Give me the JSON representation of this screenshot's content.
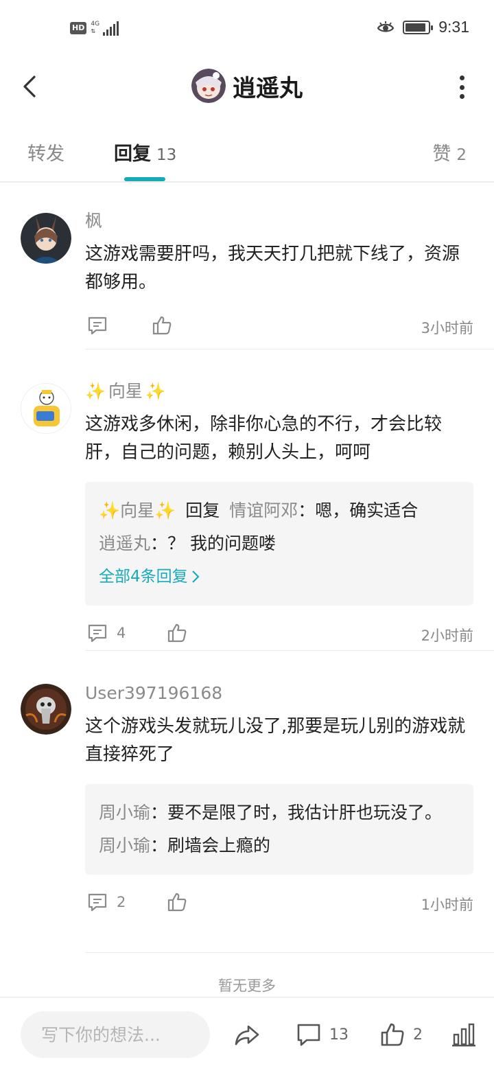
{
  "status_bar": {
    "hd": "HD",
    "network": "4G",
    "time": "9:31",
    "battery_level": 0.9
  },
  "header": {
    "title": "逍遥丸",
    "back_icon": "chevron-left-icon",
    "more_icon": "more-vertical-icon"
  },
  "tabs": {
    "forward": {
      "label": "转发"
    },
    "reply": {
      "label": "回复",
      "count": "13"
    },
    "like": {
      "label": "赞",
      "count": "2"
    }
  },
  "comments": [
    {
      "username": "枫",
      "content": "这游戏需要肝吗，我天天打几把就下线了，资源都够用。",
      "reply_count": "",
      "time": "3小时前"
    },
    {
      "username": "向星",
      "content": "这游戏多休闲，除非你心急的不行，才会比较肝，自己的问题，赖别人头上，呵呵",
      "sub_replies": [
        {
          "user": "✨向星✨",
          "reply_word": "回复",
          "target": "情谊阿邓",
          "text": "：嗯，确实适合"
        },
        {
          "user": "逍遥丸",
          "text": "：？ 我的问题喽"
        }
      ],
      "more_replies": "全部4条回复",
      "reply_count": "4",
      "time": "2小时前"
    },
    {
      "username": "User397196168",
      "content": "这个游戏头发就玩儿没了,那要是玩儿别的游戏就直接猝死了",
      "sub_replies": [
        {
          "user": "周小瑜",
          "text": "：要不是限了时，我估计肝也玩没了。"
        },
        {
          "user": "周小瑜",
          "text": "：刷墙会上瘾的"
        }
      ],
      "reply_count": "2",
      "time": "1小时前"
    }
  ],
  "no_more": "暂无更多",
  "bottom_bar": {
    "input_placeholder": "写下你的想法...",
    "comment_count": "13",
    "like_count": "2"
  },
  "colors": {
    "accent": "#17aab8",
    "muted_text": "#8a8a8a",
    "sub_reply_bg": "#f5f5f5"
  }
}
